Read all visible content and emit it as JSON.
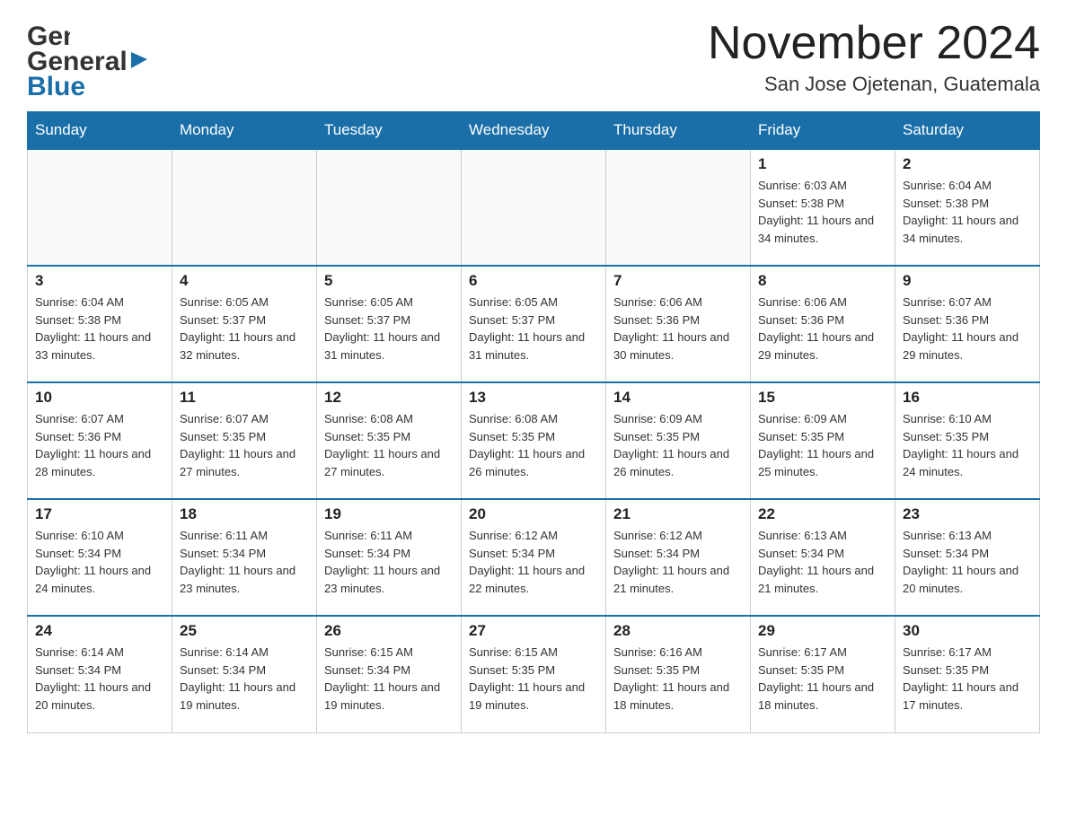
{
  "header": {
    "logo_general": "General",
    "logo_blue": "Blue",
    "title": "November 2024",
    "subtitle": "San Jose Ojetenan, Guatemala"
  },
  "calendar": {
    "days_of_week": [
      "Sunday",
      "Monday",
      "Tuesday",
      "Wednesday",
      "Thursday",
      "Friday",
      "Saturday"
    ],
    "weeks": [
      [
        {
          "day": "",
          "info": ""
        },
        {
          "day": "",
          "info": ""
        },
        {
          "day": "",
          "info": ""
        },
        {
          "day": "",
          "info": ""
        },
        {
          "day": "",
          "info": ""
        },
        {
          "day": "1",
          "info": "Sunrise: 6:03 AM\nSunset: 5:38 PM\nDaylight: 11 hours and 34 minutes."
        },
        {
          "day": "2",
          "info": "Sunrise: 6:04 AM\nSunset: 5:38 PM\nDaylight: 11 hours and 34 minutes."
        }
      ],
      [
        {
          "day": "3",
          "info": "Sunrise: 6:04 AM\nSunset: 5:38 PM\nDaylight: 11 hours and 33 minutes."
        },
        {
          "day": "4",
          "info": "Sunrise: 6:05 AM\nSunset: 5:37 PM\nDaylight: 11 hours and 32 minutes."
        },
        {
          "day": "5",
          "info": "Sunrise: 6:05 AM\nSunset: 5:37 PM\nDaylight: 11 hours and 31 minutes."
        },
        {
          "day": "6",
          "info": "Sunrise: 6:05 AM\nSunset: 5:37 PM\nDaylight: 11 hours and 31 minutes."
        },
        {
          "day": "7",
          "info": "Sunrise: 6:06 AM\nSunset: 5:36 PM\nDaylight: 11 hours and 30 minutes."
        },
        {
          "day": "8",
          "info": "Sunrise: 6:06 AM\nSunset: 5:36 PM\nDaylight: 11 hours and 29 minutes."
        },
        {
          "day": "9",
          "info": "Sunrise: 6:07 AM\nSunset: 5:36 PM\nDaylight: 11 hours and 29 minutes."
        }
      ],
      [
        {
          "day": "10",
          "info": "Sunrise: 6:07 AM\nSunset: 5:36 PM\nDaylight: 11 hours and 28 minutes."
        },
        {
          "day": "11",
          "info": "Sunrise: 6:07 AM\nSunset: 5:35 PM\nDaylight: 11 hours and 27 minutes."
        },
        {
          "day": "12",
          "info": "Sunrise: 6:08 AM\nSunset: 5:35 PM\nDaylight: 11 hours and 27 minutes."
        },
        {
          "day": "13",
          "info": "Sunrise: 6:08 AM\nSunset: 5:35 PM\nDaylight: 11 hours and 26 minutes."
        },
        {
          "day": "14",
          "info": "Sunrise: 6:09 AM\nSunset: 5:35 PM\nDaylight: 11 hours and 26 minutes."
        },
        {
          "day": "15",
          "info": "Sunrise: 6:09 AM\nSunset: 5:35 PM\nDaylight: 11 hours and 25 minutes."
        },
        {
          "day": "16",
          "info": "Sunrise: 6:10 AM\nSunset: 5:35 PM\nDaylight: 11 hours and 24 minutes."
        }
      ],
      [
        {
          "day": "17",
          "info": "Sunrise: 6:10 AM\nSunset: 5:34 PM\nDaylight: 11 hours and 24 minutes."
        },
        {
          "day": "18",
          "info": "Sunrise: 6:11 AM\nSunset: 5:34 PM\nDaylight: 11 hours and 23 minutes."
        },
        {
          "day": "19",
          "info": "Sunrise: 6:11 AM\nSunset: 5:34 PM\nDaylight: 11 hours and 23 minutes."
        },
        {
          "day": "20",
          "info": "Sunrise: 6:12 AM\nSunset: 5:34 PM\nDaylight: 11 hours and 22 minutes."
        },
        {
          "day": "21",
          "info": "Sunrise: 6:12 AM\nSunset: 5:34 PM\nDaylight: 11 hours and 21 minutes."
        },
        {
          "day": "22",
          "info": "Sunrise: 6:13 AM\nSunset: 5:34 PM\nDaylight: 11 hours and 21 minutes."
        },
        {
          "day": "23",
          "info": "Sunrise: 6:13 AM\nSunset: 5:34 PM\nDaylight: 11 hours and 20 minutes."
        }
      ],
      [
        {
          "day": "24",
          "info": "Sunrise: 6:14 AM\nSunset: 5:34 PM\nDaylight: 11 hours and 20 minutes."
        },
        {
          "day": "25",
          "info": "Sunrise: 6:14 AM\nSunset: 5:34 PM\nDaylight: 11 hours and 19 minutes."
        },
        {
          "day": "26",
          "info": "Sunrise: 6:15 AM\nSunset: 5:34 PM\nDaylight: 11 hours and 19 minutes."
        },
        {
          "day": "27",
          "info": "Sunrise: 6:15 AM\nSunset: 5:35 PM\nDaylight: 11 hours and 19 minutes."
        },
        {
          "day": "28",
          "info": "Sunrise: 6:16 AM\nSunset: 5:35 PM\nDaylight: 11 hours and 18 minutes."
        },
        {
          "day": "29",
          "info": "Sunrise: 6:17 AM\nSunset: 5:35 PM\nDaylight: 11 hours and 18 minutes."
        },
        {
          "day": "30",
          "info": "Sunrise: 6:17 AM\nSunset: 5:35 PM\nDaylight: 11 hours and 17 minutes."
        }
      ]
    ]
  }
}
